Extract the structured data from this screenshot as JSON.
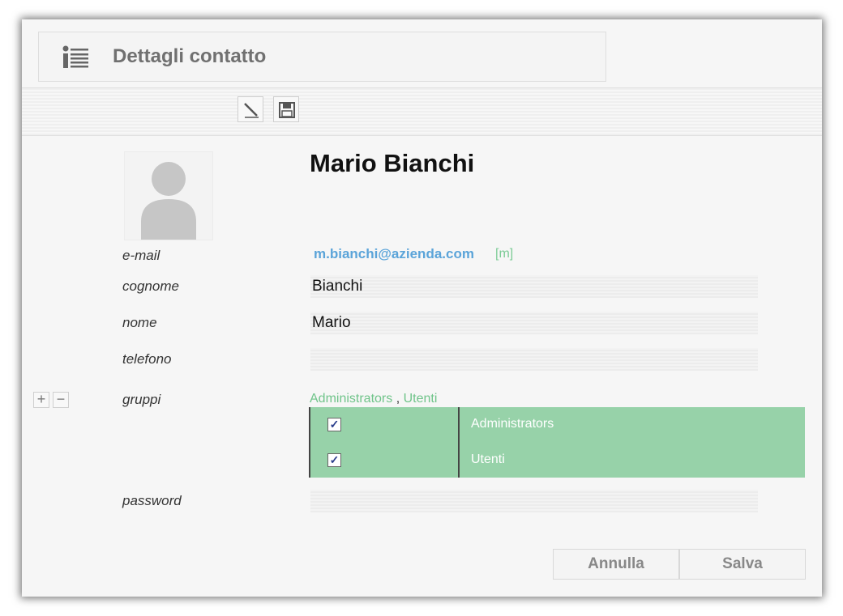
{
  "header": {
    "title": "Dettagli contatto",
    "icon": "contact-details-icon"
  },
  "toolbar": {
    "edit_icon": "pencil-icon",
    "save_icon": "floppy-disk-icon"
  },
  "contact": {
    "name": "Mario Bianchi",
    "email_label": "e-mail",
    "email": "m.bianchi@azienda.com",
    "email_tag": "[m]",
    "surname_label": "cognome",
    "surname": "Bianchi",
    "firstname_label": "nome",
    "firstname": "Mario",
    "phone_label": "telefono",
    "phone": "",
    "groups_label": "gruppi",
    "groups_inline": [
      "Administrators",
      "Utenti"
    ],
    "groups_separator": ",",
    "groups": [
      {
        "name": "Administrators",
        "checked": true
      },
      {
        "name": "Utenti",
        "checked": true
      }
    ],
    "password_label": "password",
    "password": ""
  },
  "group_controls": {
    "add_label": "+",
    "remove_label": "−"
  },
  "actions": {
    "cancel_label": "Annulla",
    "save_label": "Salva"
  },
  "colors": {
    "accent_green": "#97d2a9",
    "link_blue": "#5ba4d9",
    "group_link": "#70c48a"
  }
}
